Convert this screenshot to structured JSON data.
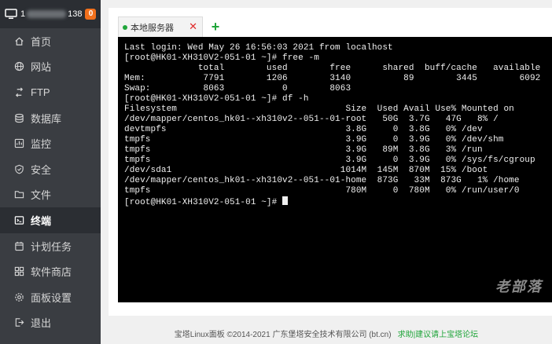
{
  "sidebar": {
    "header": {
      "ip_prefix": "1",
      "ip_suffix": "138",
      "badge": "0"
    },
    "items": [
      {
        "label": "首页",
        "icon": "home-icon"
      },
      {
        "label": "网站",
        "icon": "globe-icon"
      },
      {
        "label": "FTP",
        "icon": "ftp-icon"
      },
      {
        "label": "数据库",
        "icon": "database-icon"
      },
      {
        "label": "监控",
        "icon": "monitor-icon"
      },
      {
        "label": "安全",
        "icon": "shield-icon"
      },
      {
        "label": "文件",
        "icon": "folder-icon"
      },
      {
        "label": "终端",
        "icon": "terminal-icon",
        "active": true
      },
      {
        "label": "计划任务",
        "icon": "calendar-icon"
      },
      {
        "label": "软件商店",
        "icon": "apps-icon"
      },
      {
        "label": "面板设置",
        "icon": "settings-icon"
      },
      {
        "label": "退出",
        "icon": "logout-icon"
      }
    ]
  },
  "terminal": {
    "tab_label": "本地服务器",
    "add_tab": "+",
    "close": "✕",
    "output": [
      "Last login: Wed May 26 16:56:03 2021 from localhost",
      "[root@HK01-XH310V2-051-01 ~]# free -m",
      "              total        used        free      shared  buff/cache   available",
      "Mem:           7791        1206        3140          89        3445        6092",
      "Swap:          8063           0        8063",
      "[root@HK01-XH310V2-051-01 ~]# df -h",
      "Filesystem                                Size  Used Avail Use% Mounted on",
      "/dev/mapper/centos_hk01--xh310v2--051--01-root   50G  3.7G   47G   8% /",
      "devtmpfs                                  3.8G     0  3.8G   0% /dev",
      "tmpfs                                     3.9G     0  3.9G   0% /dev/shm",
      "tmpfs                                     3.9G   89M  3.8G   3% /run",
      "tmpfs                                     3.9G     0  3.9G   0% /sys/fs/cgroup",
      "/dev/sda1                                1014M  145M  870M  15% /boot",
      "/dev/mapper/centos_hk01--xh310v2--051--01-home  873G   33M  873G   1% /home",
      "tmpfs                                     780M     0  780M   0% /run/user/0",
      "[root@HK01-XH310V2-051-01 ~]# "
    ],
    "watermark": "老部落"
  },
  "footer": {
    "copyright": "宝塔Linux面板 ©2014-2021 广东堡塔安全技术有限公司 (bt.cn)",
    "help": "求助|建议请上宝塔论坛"
  },
  "colors": {
    "sidebar_bg": "#3a3d42",
    "accent_green": "#20a53a",
    "badge_orange": "#f2701c",
    "close_red": "#e02b2b"
  }
}
